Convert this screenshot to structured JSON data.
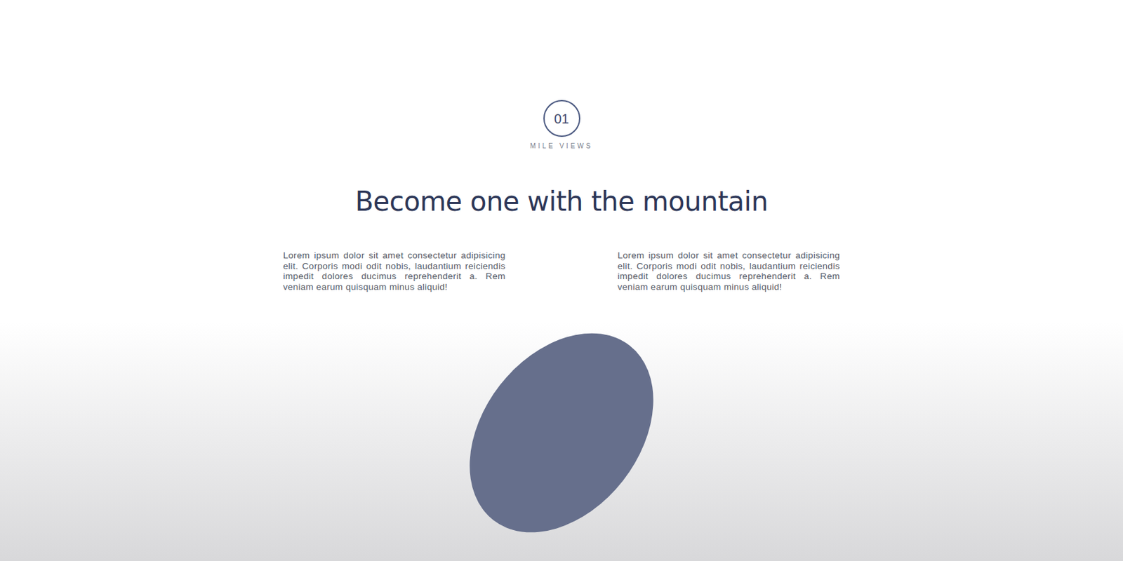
{
  "section": {
    "number": "01",
    "label": "MILE VIEWS",
    "heading": "Become one with the mountain",
    "paragraphs": [
      "Lorem ipsum dolor sit amet consectetur adipisicing elit. Corporis modi odit nobis, laudantium reiciendis impedit dolores ducimus reprehenderit a. Rem veniam earum quisquam minus aliquid!",
      "Lorem ipsum dolor sit amet consectetur adipisicing elit. Corporis modi odit nobis, laudantium reiciendis impedit dolores ducimus reprehenderit a. Rem veniam earum quisquam minus aliquid!"
    ]
  }
}
